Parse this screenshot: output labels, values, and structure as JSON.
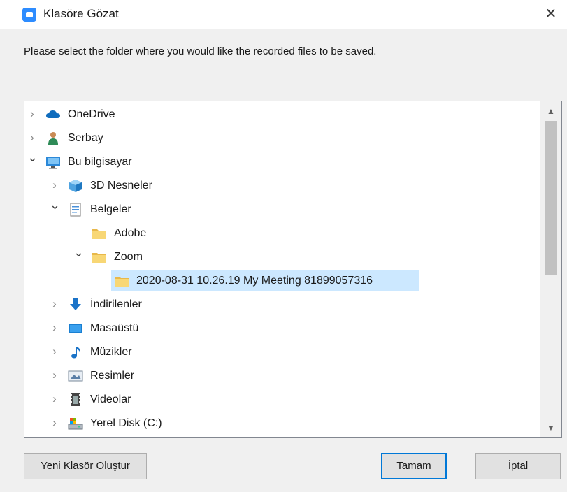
{
  "window": {
    "title": "Klasöre Gözat",
    "close_label": "✕"
  },
  "instruction": "Please select the folder where you would like the recorded files to be saved.",
  "tree": {
    "items": [
      {
        "label": "OneDrive",
        "icon": "cloud-icon",
        "expander": "collapsed",
        "level": 0
      },
      {
        "label": "Serbay",
        "icon": "user-icon",
        "expander": "collapsed",
        "level": 0
      },
      {
        "label": "Bu bilgisayar",
        "icon": "computer-icon",
        "expander": "expanded",
        "level": 0
      },
      {
        "label": "3D Nesneler",
        "icon": "cube-icon",
        "expander": "collapsed",
        "level": 1
      },
      {
        "label": "Belgeler",
        "icon": "document-icon",
        "expander": "expanded",
        "level": 1
      },
      {
        "label": "Adobe",
        "icon": "folder-icon",
        "expander": "none",
        "level": 2
      },
      {
        "label": "Zoom",
        "icon": "folder-icon",
        "expander": "expanded",
        "level": 2
      },
      {
        "label": "2020-08-31 10.26.19 My Meeting 81899057316",
        "icon": "folder-icon",
        "expander": "none",
        "level": 3,
        "selected": true
      },
      {
        "label": "İndirilenler",
        "icon": "download-icon",
        "expander": "collapsed",
        "level": 1
      },
      {
        "label": "Masaüstü",
        "icon": "desktop-icon",
        "expander": "collapsed",
        "level": 1
      },
      {
        "label": "Müzikler",
        "icon": "music-icon",
        "expander": "collapsed",
        "level": 1
      },
      {
        "label": "Resimler",
        "icon": "pictures-icon",
        "expander": "collapsed",
        "level": 1
      },
      {
        "label": "Videolar",
        "icon": "video-icon",
        "expander": "collapsed",
        "level": 1
      },
      {
        "label": "Yerel Disk (C:)",
        "icon": "disk-icon",
        "expander": "collapsed",
        "level": 1
      }
    ],
    "scroll_position": 0.0,
    "scroll_visible_fraction": 0.52
  },
  "buttons": {
    "new_folder": "Yeni Klasör Oluştur",
    "ok": "Tamam",
    "cancel": "İptal"
  },
  "colors": {
    "selection": "#cce8ff",
    "accent": "#0078d7",
    "folder": "#f8d775"
  }
}
